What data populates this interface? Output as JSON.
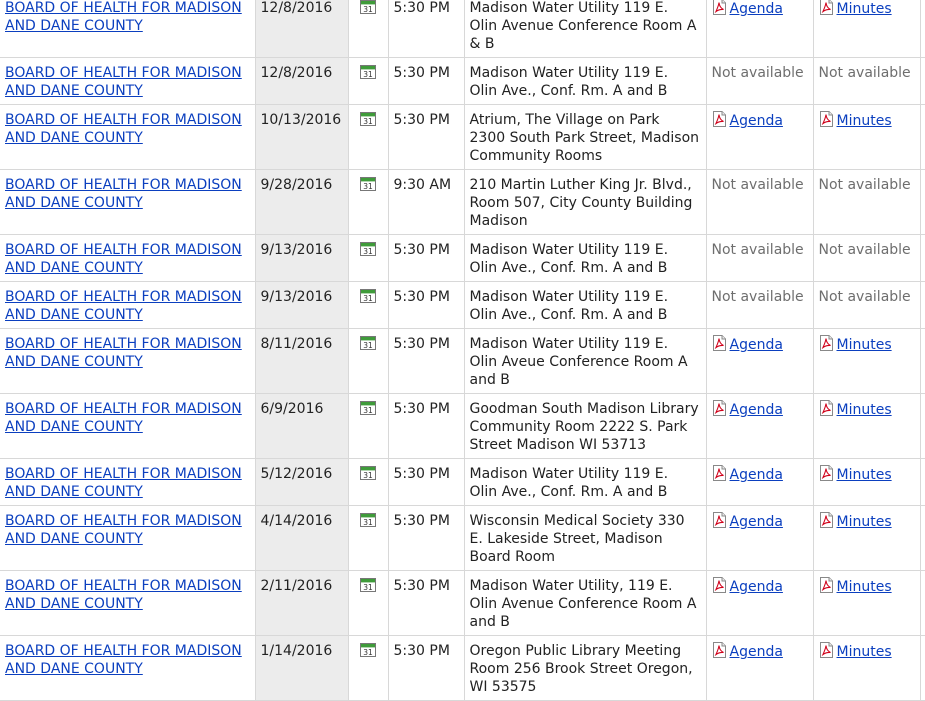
{
  "meetings": [
    {
      "name": "BOARD OF HEALTH FOR MADISON AND DANE COUNTY",
      "date": "12/8/2016",
      "time": "5:30 PM",
      "location": "Madison Water Utility 119 E. Olin Avenue Conference Room A & B",
      "agenda": "Agenda",
      "minutes": "Minutes",
      "has_agenda": true,
      "has_minutes": true
    },
    {
      "name": "BOARD OF HEALTH FOR MADISON AND DANE COUNTY",
      "date": "12/8/2016",
      "time": "5:30 PM",
      "location": "Madison Water Utility 119 E. Olin Ave., Conf. Rm. A and B",
      "agenda": "Not available",
      "minutes": "Not available",
      "has_agenda": false,
      "has_minutes": false
    },
    {
      "name": "BOARD OF HEALTH FOR MADISON AND DANE COUNTY",
      "date": "10/13/2016",
      "time": "5:30 PM",
      "location": "Atrium, The Village on Park 2300 South Park Street, Madison Community Rooms",
      "agenda": "Agenda",
      "minutes": "Minutes",
      "has_agenda": true,
      "has_minutes": true
    },
    {
      "name": "BOARD OF HEALTH FOR MADISON AND DANE COUNTY",
      "date": "9/28/2016",
      "time": "9:30 AM",
      "location": "210 Martin Luther King Jr. Blvd., Room 507, City County Building Madison",
      "agenda": "Not available",
      "minutes": "Not available",
      "has_agenda": false,
      "has_minutes": false
    },
    {
      "name": "BOARD OF HEALTH FOR MADISON AND DANE COUNTY",
      "date": "9/13/2016",
      "time": "5:30 PM",
      "location": "Madison Water Utility 119 E. Olin Ave., Conf. Rm. A and B",
      "agenda": "Not available",
      "minutes": "Not available",
      "has_agenda": false,
      "has_minutes": false
    },
    {
      "name": "BOARD OF HEALTH FOR MADISON AND DANE COUNTY",
      "date": "9/13/2016",
      "time": "5:30 PM",
      "location": "Madison Water Utility 119 E. Olin Ave., Conf. Rm. A and B",
      "agenda": "Not available",
      "minutes": "Not available",
      "has_agenda": false,
      "has_minutes": false
    },
    {
      "name": "BOARD OF HEALTH FOR MADISON AND DANE COUNTY",
      "date": "8/11/2016",
      "time": "5:30 PM",
      "location": "Madison Water Utility 119 E. Olin Aveue Conference Room A and B",
      "agenda": "Agenda",
      "minutes": "Minutes",
      "has_agenda": true,
      "has_minutes": true
    },
    {
      "name": "BOARD OF HEALTH FOR MADISON AND DANE COUNTY",
      "date": "6/9/2016",
      "time": "5:30 PM",
      "location": "Goodman South Madison Library Community Room 2222 S. Park Street Madison WI 53713",
      "agenda": "Agenda",
      "minutes": "Minutes",
      "has_agenda": true,
      "has_minutes": true
    },
    {
      "name": "BOARD OF HEALTH FOR MADISON AND DANE COUNTY",
      "date": "5/12/2016",
      "time": "5:30 PM",
      "location": "Madison Water Utility 119 E. Olin Ave., Conf. Rm. A and B",
      "agenda": "Agenda",
      "minutes": "Minutes",
      "has_agenda": true,
      "has_minutes": true
    },
    {
      "name": "BOARD OF HEALTH FOR MADISON AND DANE COUNTY",
      "date": "4/14/2016",
      "time": "5:30 PM",
      "location": "Wisconsin Medical Society 330 E. Lakeside Street, Madison Board Room",
      "agenda": "Agenda",
      "minutes": "Minutes",
      "has_agenda": true,
      "has_minutes": true
    },
    {
      "name": "BOARD OF HEALTH FOR MADISON AND DANE COUNTY",
      "date": "2/11/2016",
      "time": "5:30 PM",
      "location": "Madison Water Utility, 119 E. Olin Avenue Conference Room A and B",
      "agenda": "Agenda",
      "minutes": "Minutes",
      "has_agenda": true,
      "has_minutes": true
    },
    {
      "name": "BOARD OF HEALTH FOR MADISON AND DANE COUNTY",
      "date": "1/14/2016",
      "time": "5:30 PM",
      "location": "Oregon Public Library Meeting Room 256 Brook Street Oregon, WI 53575",
      "agenda": "Agenda",
      "minutes": "Minutes",
      "has_agenda": true,
      "has_minutes": true
    }
  ],
  "icons": {
    "calendar_label": "31",
    "calendar": "calendar-icon",
    "document": "pdf-icon"
  },
  "colors": {
    "link": "#0b3fbf",
    "not_available": "#6e6e6e",
    "date_column_bg": "#ececec",
    "calendar_green": "#3f9b3a",
    "pdf_red": "#d0021b"
  }
}
